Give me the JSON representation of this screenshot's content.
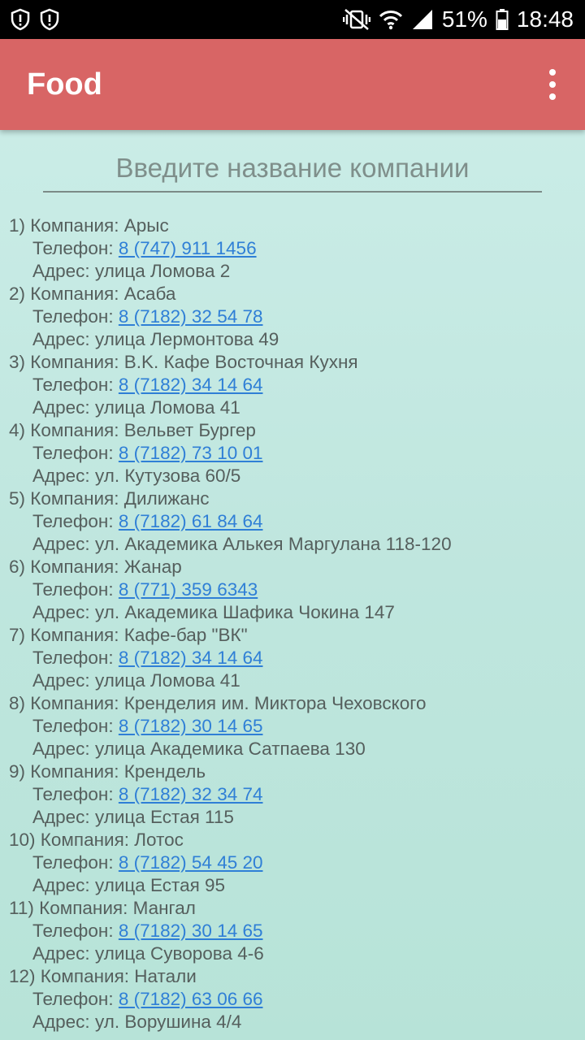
{
  "status_bar": {
    "left_icons": [
      "alert-shield-icon",
      "alert-shield-icon"
    ],
    "battery": "51%",
    "time": "18:48"
  },
  "app_bar": {
    "title": "Food"
  },
  "search": {
    "placeholder": "Введите название компании",
    "value": ""
  },
  "labels": {
    "company": "Компания:",
    "phone": "Телефон:",
    "address": "Адрес:"
  },
  "companies": [
    {
      "num": "1)",
      "name": "Арыс",
      "phone": "8 (747) 911 1456",
      "address": "улица Ломова 2"
    },
    {
      "num": "2)",
      "name": "Асаба",
      "phone": "8 (7182) 32 54 78",
      "address": "улица Лермонтова 49"
    },
    {
      "num": "3)",
      "name": "B.K. Кафе Восточная Кухня",
      "phone": "8 (7182) 34 14 64",
      "address": "улица Ломова 41"
    },
    {
      "num": "4)",
      "name": "Вельвет Бургер",
      "phone": "8 (7182) 73 10 01",
      "address": "ул. Кутузова 60/5"
    },
    {
      "num": "5)",
      "name": "Дилижанс",
      "phone": "8 (7182) 61 84 64",
      "address": "ул. Академика Алькея Маргулана 118-120"
    },
    {
      "num": "6)",
      "name": "Жанар",
      "phone": "8 (771) 359 6343",
      "address": "ул. Академика Шафика Чокина 147"
    },
    {
      "num": "7)",
      "name": "Кафе-бар \"ВК\"",
      "phone": "8 (7182) 34 14 64",
      "address": "улица Ломова 41"
    },
    {
      "num": "8)",
      "name": "Кренделия им. Миктора Чеховского",
      "phone": "8 (7182) 30 14 65",
      "address": "улица Академика Сатпаева 130"
    },
    {
      "num": "9)",
      "name": "Крендель",
      "phone": "8 (7182) 32 34 74",
      "address": "улица Естая 115"
    },
    {
      "num": "10)",
      "name": "Лотос",
      "phone": "8 (7182) 54 45 20",
      "address": "улица Естая 95"
    },
    {
      "num": "11)",
      "name": "Мангал",
      "phone": "8 (7182) 30 14 65",
      "address": "улица Суворова 4-6"
    },
    {
      "num": "12)",
      "name": "Натали",
      "phone": "8 (7182) 63 06 66",
      "address": "ул. Ворушина 4/4"
    }
  ]
}
